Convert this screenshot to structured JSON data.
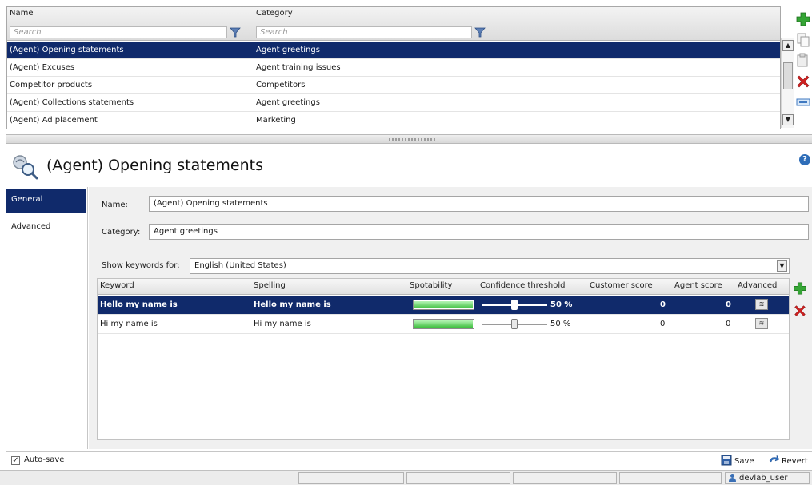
{
  "list": {
    "columns": {
      "name": "Name",
      "category": "Category"
    },
    "filters": {
      "name_placeholder": "Search",
      "category_placeholder": "Search"
    },
    "rows": [
      {
        "name": "(Agent) Opening statements",
        "category": "Agent greetings",
        "selected": true
      },
      {
        "name": "(Agent) Excuses",
        "category": "Agent training issues",
        "selected": false
      },
      {
        "name": "Competitor products",
        "category": "Competitors",
        "selected": false
      },
      {
        "name": "(Agent) Collections statements",
        "category": "Agent greetings",
        "selected": false
      },
      {
        "name": "(Agent) Ad placement",
        "category": "Marketing",
        "selected": false
      }
    ],
    "side_actions": [
      "add-icon",
      "copy-icon",
      "paste-icon",
      "delete-icon",
      "collapse-icon"
    ]
  },
  "detail": {
    "title": "(Agent) Opening statements",
    "help_label": "?"
  },
  "nav": {
    "items": [
      {
        "label": "General",
        "selected": true
      },
      {
        "label": "Advanced",
        "selected": false
      }
    ]
  },
  "form": {
    "name_label": "Name:",
    "name_value": "(Agent) Opening statements",
    "category_label": "Category:",
    "category_value": "Agent greetings",
    "language_label": "Show keywords for:",
    "language_value": "English (United States)"
  },
  "keywords": {
    "headers": {
      "keyword": "Keyword",
      "spelling": "Spelling",
      "spotability": "Spotability",
      "confidence": "Confidence threshold",
      "customer_score": "Customer score",
      "agent_score": "Agent score",
      "advanced": "Advanced"
    },
    "rows": [
      {
        "keyword": "Hello my name is",
        "spelling": "Hello my name is",
        "spotability": 1.0,
        "confidence": 0.5,
        "confidence_label": "50 %",
        "customer_score": "0",
        "agent_score": "0",
        "selected": true
      },
      {
        "keyword": "Hi my name is",
        "spelling": "Hi my name is",
        "spotability": 1.0,
        "confidence": 0.5,
        "confidence_label": "50 %",
        "customer_score": "0",
        "agent_score": "0",
        "selected": false
      }
    ]
  },
  "footer": {
    "autosave_label": "Auto-save",
    "autosave_checked": true,
    "save_label": "Save",
    "revert_label": "Revert"
  },
  "status": {
    "user": "devlab_user"
  },
  "colors": {
    "selection": "#102a6b",
    "add": "#2e9a2e",
    "delete": "#d42020",
    "spot_fill": "#3fbf3f"
  }
}
